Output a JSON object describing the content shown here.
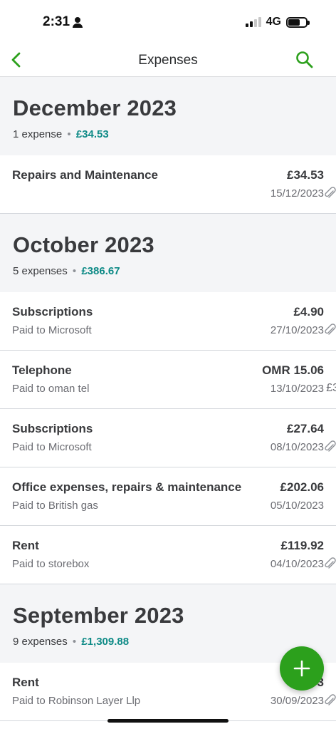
{
  "status_bar": {
    "time": "2:31",
    "network": "4G"
  },
  "nav": {
    "title": "Expenses"
  },
  "colors": {
    "accent_green": "#2ca01c",
    "total_teal": "#0d8a86",
    "section_bg": "#f4f5f7"
  },
  "months": [
    {
      "title": "December 2023",
      "count": "1 expense",
      "dot": "•",
      "total": "£34.53",
      "items": [
        {
          "category": "Repairs and Maintenance",
          "payee": "",
          "amount": "£34.53",
          "date": "15/12/2023",
          "attachment": true
        }
      ]
    },
    {
      "title": "October 2023",
      "count": "5 expenses",
      "dot": "•",
      "total": "£386.67",
      "items": [
        {
          "category": "Subscriptions",
          "payee": "Paid to Microsoft",
          "amount": "£4.90",
          "date": "27/10/2023",
          "attachment": true
        },
        {
          "category": "Telephone",
          "payee": "Paid to oman tel",
          "amount": "OMR 15.06",
          "date": "13/10/2023",
          "attachment": false,
          "trailing": "£3"
        },
        {
          "category": "Subscriptions",
          "payee": "Paid to Microsoft",
          "amount": "£27.64",
          "date": "08/10/2023",
          "attachment": true
        },
        {
          "category": "Office expenses, repairs & maintenance",
          "payee": "Paid to British gas",
          "amount": "£202.06",
          "date": "05/10/2023",
          "attachment": false
        },
        {
          "category": "Rent",
          "payee": "Paid to storebox",
          "amount": "£119.92",
          "date": "04/10/2023",
          "attachment": true
        }
      ]
    },
    {
      "title": "September 2023",
      "count": "9 expenses",
      "dot": "•",
      "total": "£1,309.88",
      "items": [
        {
          "category": "Rent",
          "payee": "Paid to Robinson Layer Llp",
          "amount": "£1,0  3",
          "date": "30/09/2023",
          "attachment": true
        }
      ]
    }
  ],
  "icons": {
    "back": "chevron-left-icon",
    "search": "search-icon",
    "add": "plus-icon",
    "attachment": "paperclip-icon"
  }
}
